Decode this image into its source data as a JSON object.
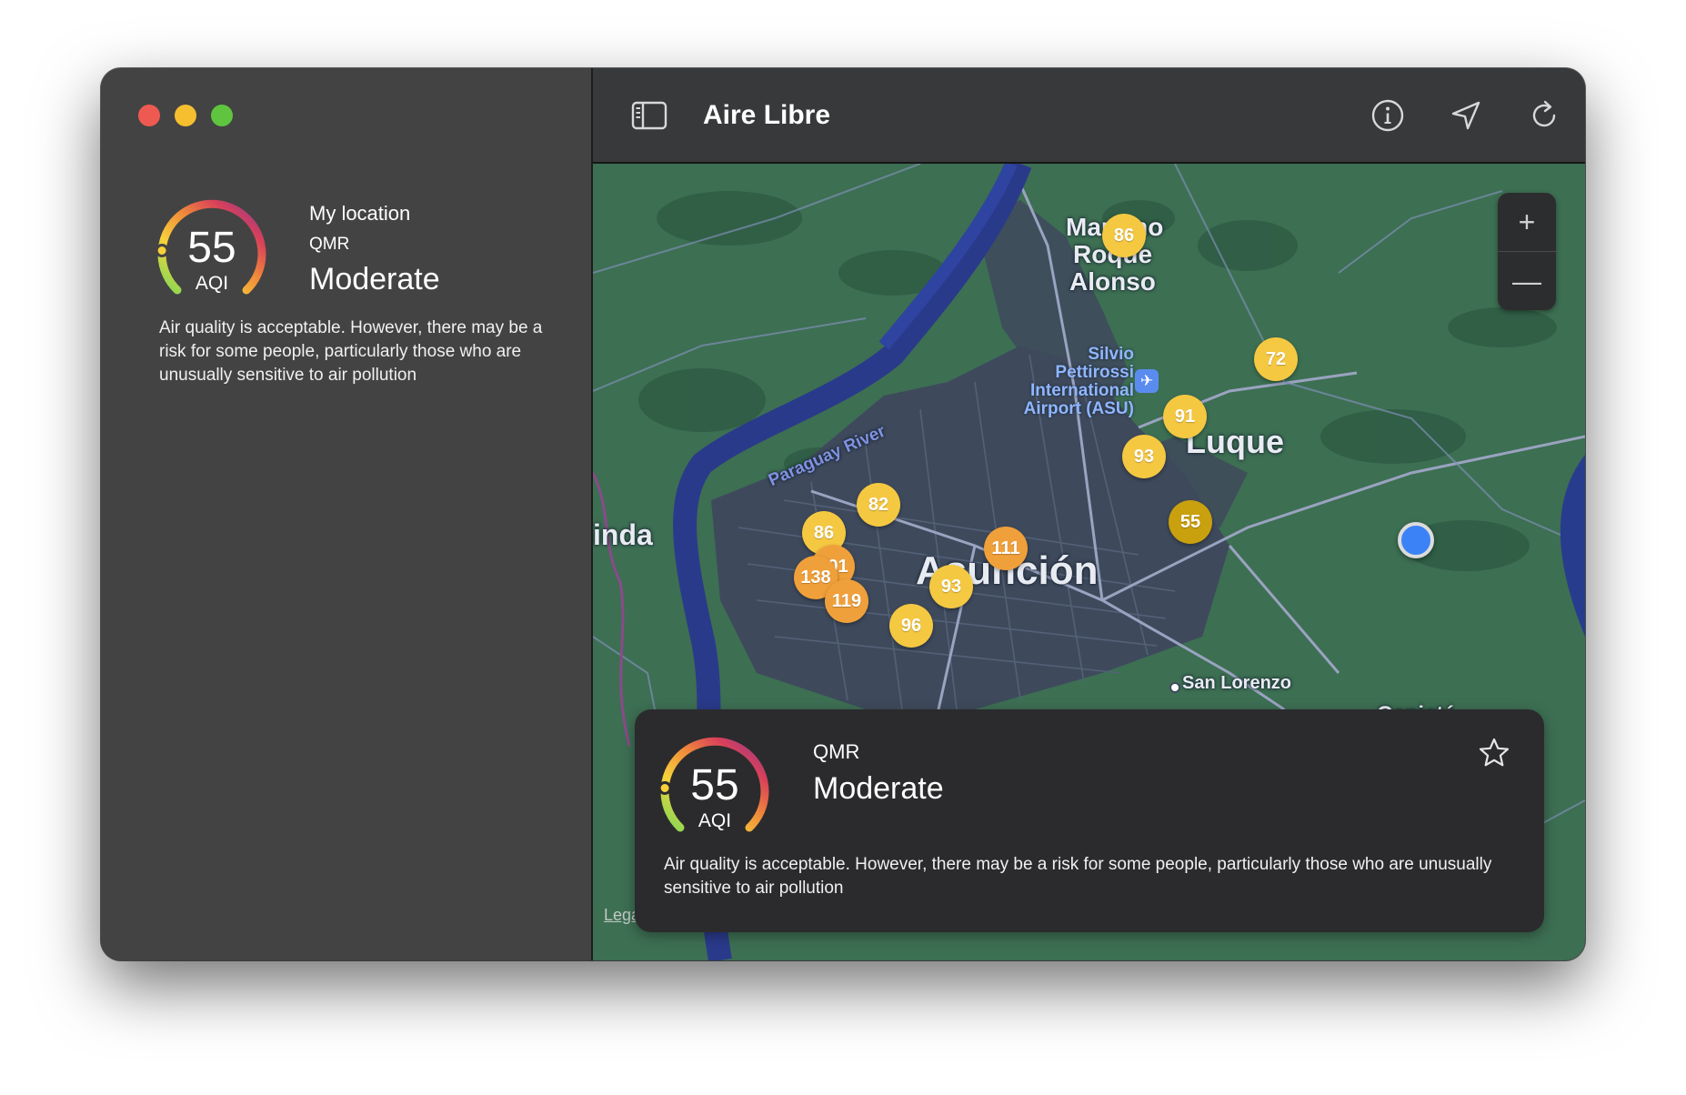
{
  "window": {
    "title": "Aire Libre",
    "controls": [
      "close",
      "minimize",
      "zoom"
    ]
  },
  "colors": {
    "sidebar_bg": "#434343",
    "card_bg": "#2b2b2d",
    "aqi_moderate": "#f5c842",
    "aqi_moderate_dark": "#c9a00d",
    "aqi_sensitive": "#f0a03a",
    "user_location": "#3b82f6"
  },
  "sidebar": {
    "location_label": "My location",
    "station": "QMR",
    "aqi_value": "55",
    "aqi_unit": "AQI",
    "aqi_fraction": 0.18,
    "category": "Moderate",
    "description": "Air quality is acceptable. However, there may be a risk for some people, particularly those who are unusually sensitive to air pollution"
  },
  "toolbar": {
    "sidebar_toggle_icon": "sidebar-icon",
    "title": "Aire Libre",
    "info_icon": "info-icon",
    "location_icon": "location-arrow-icon",
    "refresh_icon": "refresh-icon"
  },
  "map": {
    "labels": {
      "mariano": "Mariano",
      "roque": "Roque",
      "alonso": "Alonso",
      "airport_line1": "Silvio",
      "airport_line2": "Pettirossi",
      "airport_line3": "International",
      "airport_line4": "Airport (ASU)",
      "river": "Paraguay River",
      "luque": "Luque",
      "asuncion": "Asunción",
      "limpio_partial": "inda",
      "san_lorenzo": "San Lorenzo",
      "capiata_partial": "Capiatá"
    },
    "markers": [
      {
        "value": "86",
        "level": "moderate"
      },
      {
        "value": "72",
        "level": "moderate"
      },
      {
        "value": "91",
        "level": "moderate"
      },
      {
        "value": "93",
        "level": "moderate"
      },
      {
        "value": "55",
        "level": "moderate-selected"
      },
      {
        "value": "82",
        "level": "moderate"
      },
      {
        "value": "86",
        "level": "moderate"
      },
      {
        "value": "111",
        "level": "sensitive"
      },
      {
        "value": "101",
        "level": "sensitive"
      },
      {
        "value": "138",
        "level": "sensitive"
      },
      {
        "value": "119",
        "level": "sensitive"
      },
      {
        "value": "93",
        "level": "moderate"
      },
      {
        "value": "96",
        "level": "moderate"
      }
    ],
    "zoom_in": "+",
    "zoom_out": "—",
    "legal": "Legal"
  },
  "card": {
    "station": "QMR",
    "category": "Moderate",
    "aqi_value": "55",
    "aqi_unit": "AQI",
    "aqi_fraction": 0.18,
    "favorite_icon": "star-icon",
    "description": "Air quality is acceptable. However, there may be a risk for some people, particularly those who are unusually sensitive to air pollution"
  }
}
